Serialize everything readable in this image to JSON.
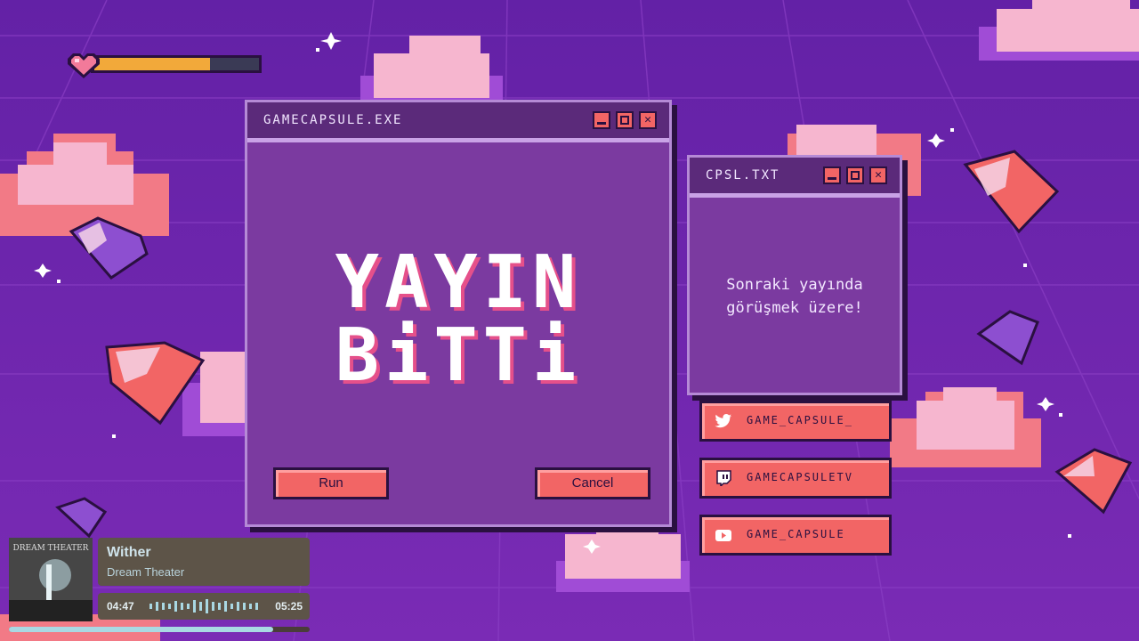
{
  "colors": {
    "background": "#6a24a8",
    "window": "#7b3aa0",
    "accent": "#f26565",
    "dark": "#2a1040"
  },
  "health_bar": {
    "level": 0.7
  },
  "main_window": {
    "title": "GAMECAPSULE.EXE",
    "headline_line1": "YAYIN",
    "headline_line2": "BiTTi",
    "run_label": "Run",
    "cancel_label": "Cancel",
    "controls": [
      "minimize-icon",
      "maximize-icon",
      "close-icon"
    ]
  },
  "side_window": {
    "title": "CPSL.TXT",
    "message_line1": "Sonraki yayında",
    "message_line2": "görüşmek üzere!",
    "controls": [
      "minimize-icon",
      "maximize-icon",
      "close-icon"
    ]
  },
  "socials": [
    {
      "icon": "twitter-icon",
      "label": "GAME_CAPSULE_"
    },
    {
      "icon": "twitch-icon",
      "label": "GAMECAPSULETV"
    },
    {
      "icon": "youtube-icon",
      "label": "GAME_CAPSULE"
    }
  ],
  "now_playing": {
    "title": "Wither",
    "artist": "Dream Theater",
    "elapsed": "04:47",
    "duration": "05:25",
    "progress": 0.88,
    "album_art_text": "DREAM THEATER"
  }
}
